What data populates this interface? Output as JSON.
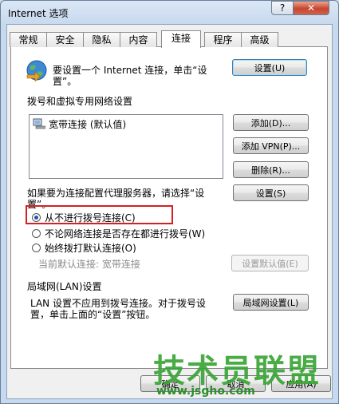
{
  "window": {
    "title": "Internet 选项",
    "help_label": "?",
    "close_label": "✕"
  },
  "tabs": [
    {
      "label": "常规"
    },
    {
      "label": "安全"
    },
    {
      "label": "隐私"
    },
    {
      "label": "内容"
    },
    {
      "label": "连接",
      "active": true
    },
    {
      "label": "程序"
    },
    {
      "label": "高级"
    }
  ],
  "setup": {
    "text_line1": "要设置一个 Internet 连接，单击“设",
    "text_line2": "置”。",
    "button": "设置(U)"
  },
  "dialup": {
    "heading": "拨号和虚拟专用网络设置",
    "list_items": [
      "宽带连接 (默认值)"
    ],
    "add_button": "添加(D)...",
    "add_vpn_button": "添加 VPN(P)...",
    "remove_button": "删除(R)...",
    "proxy_text_line1": "如果要为连接配置代理服务器，请选择“设",
    "proxy_text_line2": "置”。",
    "settings_button": "设置(S)"
  },
  "dial_options": [
    {
      "label": "从不进行拨号连接(C)",
      "selected": true
    },
    {
      "label": "不论网络连接是否存在都进行拨号(W)",
      "selected": false
    },
    {
      "label": "始终拨打默认连接(O)",
      "selected": false
    }
  ],
  "default_connection": {
    "label": "当前默认连接: 宽带连接",
    "button": "设置默认值(E)"
  },
  "lan": {
    "heading": "局域网(LAN)设置",
    "text_line1": "LAN 设置不应用到拨号连接。对于拨号设",
    "text_line2": "置，单击上面的“设置”按钮。",
    "button": "局域网设置(L)"
  },
  "footer": {
    "ok_button": "确定",
    "cancel_button": "取消",
    "apply_button": "应用(A)"
  },
  "watermark": {
    "title": "技术员联盟",
    "url": "www.jsgho.com"
  },
  "colors": {
    "accent": "#1f55b3",
    "highlight_box": "#d42020",
    "watermark": "#3aa536"
  }
}
